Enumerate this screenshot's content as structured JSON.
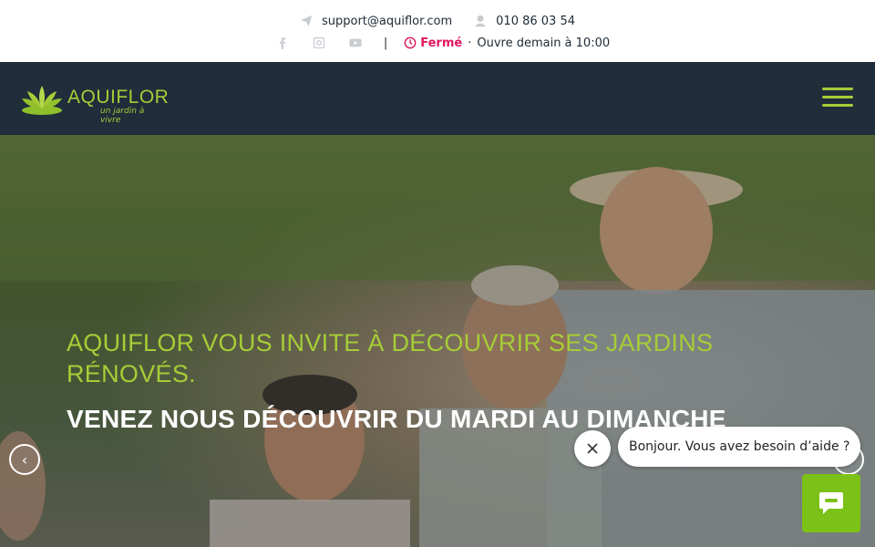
{
  "topbar": {
    "email": "support@aquiflor.com",
    "phone": "010 86 03 54",
    "social": [
      "facebook-icon",
      "instagram-icon",
      "youtube-icon"
    ],
    "separator": "|",
    "status": "Fermé",
    "status_dot": "·",
    "opening": "Ouvre demain à 10:00"
  },
  "nav": {
    "logo_text": "AQUIFLOR",
    "logo_tagline": "un jardin à vivre",
    "menu_icon": "hamburger-icon"
  },
  "hero": {
    "title": "AQUIFLOR VOUS INVITE À DÉCOUVRIR SES JARDINS RÉNOVÉS.",
    "subtitle": "VENEZ NOUS DÉCOUVRIR DU MARDI AU DIMANCHE",
    "prev_icon": "‹",
    "next_icon": "›"
  },
  "chat": {
    "message": "Bonjour. Vous avez besoin d’aide ?",
    "close_icon": "close-icon",
    "chat_icon": "chat-icon"
  },
  "colors": {
    "accent": "#a6cd37",
    "nav_bg": "#1f2e3a",
    "closed": "#e0165f",
    "chat_button": "#7cc117"
  }
}
